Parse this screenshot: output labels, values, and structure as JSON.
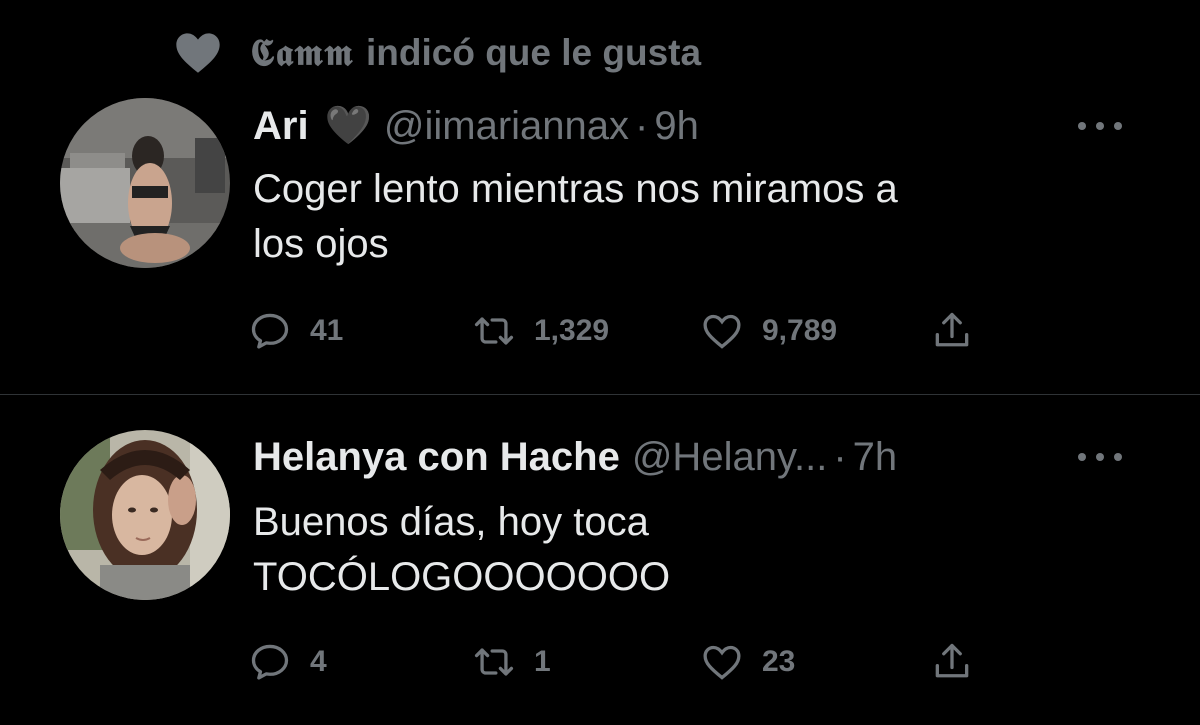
{
  "social_context": {
    "user": "𝕮𝖆𝖒𝖒",
    "action": "indicó que le gusta"
  },
  "tweets": [
    {
      "name": "Ari",
      "emoji": "🖤",
      "handle": "@iimariannax",
      "dot": "·",
      "time": "9h",
      "text_lines": [
        "Coger lento mientras nos miramos a",
        "los ojos"
      ],
      "replies": "41",
      "retweets": "1,329",
      "likes": "9,789"
    },
    {
      "name": "Helanya con Hache",
      "handle": "@Helany...",
      "dot": "·",
      "time": "7h",
      "text_lines": [
        "Buenos días, hoy toca",
        "TOCÓLOGOOOOOOO"
      ],
      "replies": "4",
      "retweets": "1",
      "likes": "23"
    }
  ],
  "icons": {
    "social": "heart-filled-icon",
    "reply": "reply-icon",
    "retweet": "retweet-icon",
    "like": "heart-outline-icon",
    "share": "share-icon",
    "more": "more-icon"
  },
  "colors": {
    "background": "#000000",
    "text": "#e7e9ea",
    "secondary": "#71767b",
    "divider": "#2f3336"
  }
}
